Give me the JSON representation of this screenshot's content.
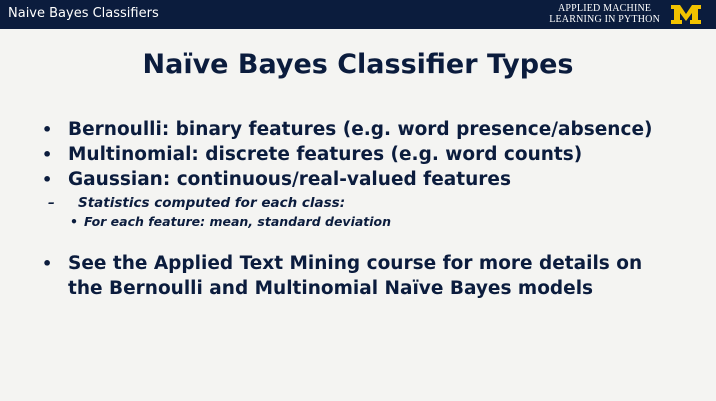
{
  "header": {
    "title": "Naive Bayes Classifiers",
    "course_line1": "APPLIED MACHINE",
    "course_line2": "LEARNING IN PYTHON",
    "logo_text": "M",
    "colors": {
      "bar": "#0b1c3d",
      "logo": "#f2c200"
    }
  },
  "slide": {
    "title": "Naïve Bayes Classifier Types",
    "bullets": [
      "Bernoulli:  binary features (e.g. word presence/absence)",
      "Multinomial:  discrete features (e.g. word counts)",
      "Gaussian: continuous/real-valued features"
    ],
    "sub_bullet": "Statistics computed for each class:",
    "sub_sub_bullet": "For each feature:   mean,  standard deviation",
    "final_bullet": "See the Applied Text Mining course for more details on the Bernoulli and Multinomial Naïve Bayes models",
    "bullet_char": "•",
    "dash_char": "–",
    "text_color": "#0b1c3d"
  }
}
